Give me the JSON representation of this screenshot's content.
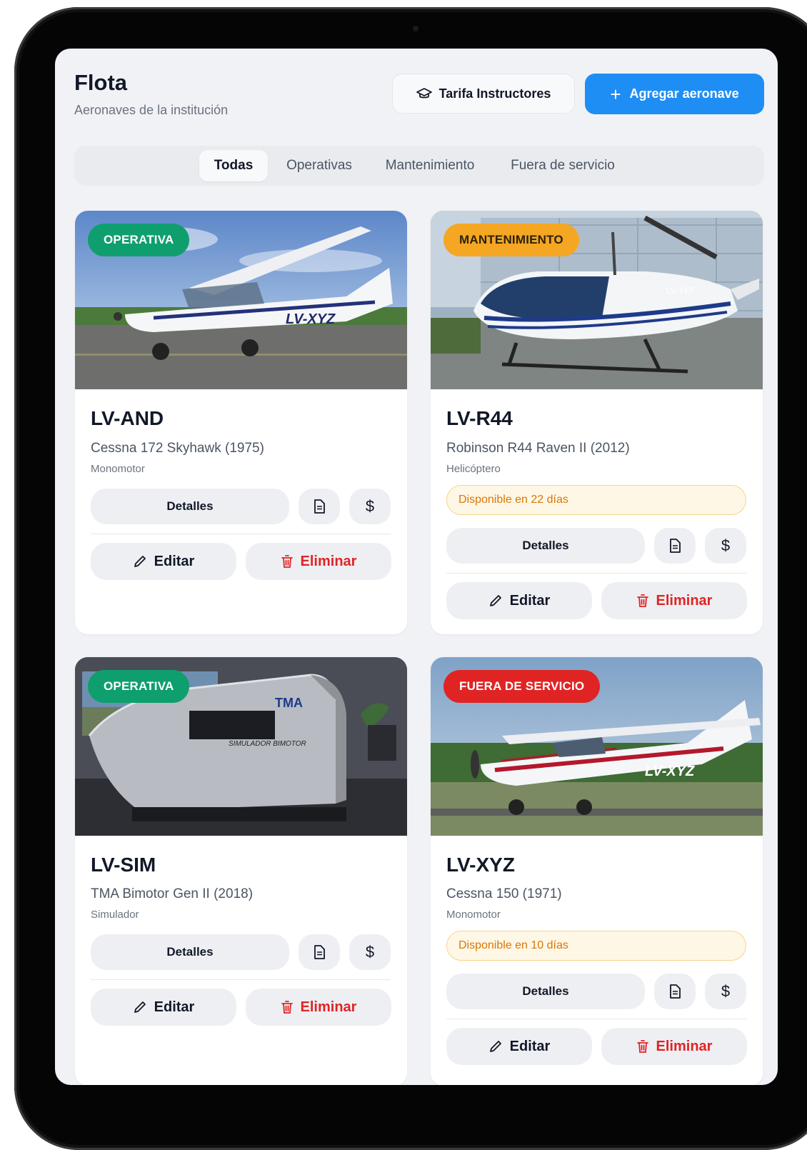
{
  "header": {
    "title": "Flota",
    "subtitle": "Aeronaves de la institución",
    "tarifa_label": "Tarifa Instructores",
    "add_label": "Agregar aeronave",
    "add_plus": "+"
  },
  "tabs": [
    "Todas",
    "Operativas",
    "Mantenimiento",
    "Fuera de servicio"
  ],
  "colors": {
    "accent": "#1e8ef5",
    "operativa": "#0f9f6e",
    "mantenimiento": "#f5a623",
    "fuera": "#e02424",
    "warning_text": "#d97706"
  },
  "icons": {
    "tarifa": "graduation-cap-icon",
    "add": "plus-icon",
    "document": "document-icon",
    "price": "dollar-icon",
    "edit": "pencil-icon",
    "delete": "trash-icon"
  },
  "actions": {
    "details": "Detalles",
    "edit": "Editar",
    "delete": "Eliminar",
    "price_symbol": "$"
  },
  "aircraft": [
    {
      "status": "OPERATIVA",
      "registration": "LV-AND",
      "model": "Cessna 172 Skyhawk (1975)",
      "category": "Monomotor",
      "availability": ""
    },
    {
      "status": "MANTENIMIENTO",
      "registration": "LV-R44",
      "model": "Robinson R44 Raven II (2012)",
      "category": "Helicóptero",
      "availability": "Disponible en 22 días"
    },
    {
      "status": "OPERATIVA",
      "registration": "LV-SIM",
      "model": "TMA Bimotor Gen II (2018)",
      "category": "Simulador",
      "availability": ""
    },
    {
      "status": "FUERA DE SERVICIO",
      "registration": "LV-XYZ",
      "model": "Cessna 150 (1971)",
      "category": "Monomotor",
      "availability": "Disponible en 10 días"
    }
  ]
}
